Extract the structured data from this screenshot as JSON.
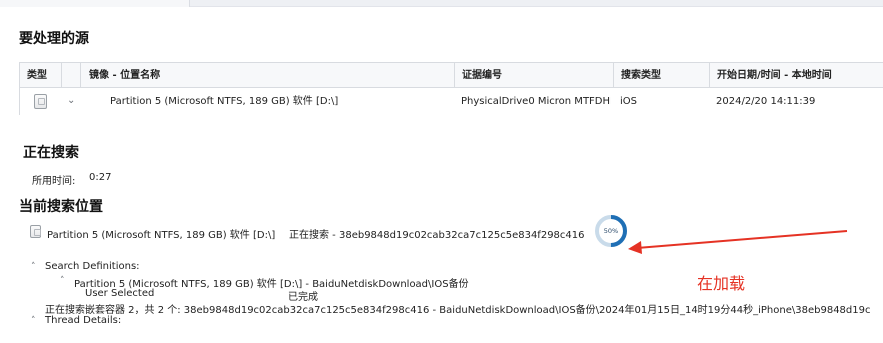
{
  "section_source": {
    "title": "要处理的源"
  },
  "source_table": {
    "headers": {
      "type": "类型",
      "image_location": "镜像 - 位置名称",
      "evidence_number": "证据编号",
      "search_type": "搜索类型",
      "start_time": "开始日期/时间 - 本地时间"
    },
    "row": {
      "icon": "drive-icon",
      "expand_icon": "chevron-down-icon",
      "location": "Partition 5 (Microsoft NTFS, 189 GB) 软件 [D:\\]",
      "evidence_number": "PhysicalDrive0 Micron MTFDHB",
      "search_type": "iOS",
      "start_time": "2024/2/20 14:11:39"
    }
  },
  "searching": {
    "title": "正在搜索",
    "elapsed_label": "所用时间:",
    "elapsed_value": "0:27"
  },
  "current_location": {
    "title": "当前搜索位置",
    "partition": "Partition 5 (Microsoft NTFS, 189 GB) 软件 [D:\\]",
    "status": "正在搜索 - 38eb9848d19c02cab32ca7c125c5e834f298c416",
    "progress_text": "50%",
    "progress": 0.5,
    "progress_color": "#1f6fb5"
  },
  "details": {
    "search_definitions_label": "Search Definitions:",
    "definition_path": "Partition 5 (Microsoft NTFS, 189 GB) 软件 [D:\\] - BaiduNetdiskDownload\\IOS备份",
    "user_selected": "User Selected",
    "completed": "已完成",
    "container_line": "正在搜索嵌套容器 2，共 2 个:  38eb9848d19c02cab32ca7c125c5e834f298c416 - BaiduNetdiskDownload\\IOS备份\\2024年01月15日_14时19分44秒_iPhone\\38eb9848d19c",
    "thread_details_label": "Thread Details:"
  },
  "annotation": {
    "text": "在加载",
    "color": "#e53224"
  }
}
